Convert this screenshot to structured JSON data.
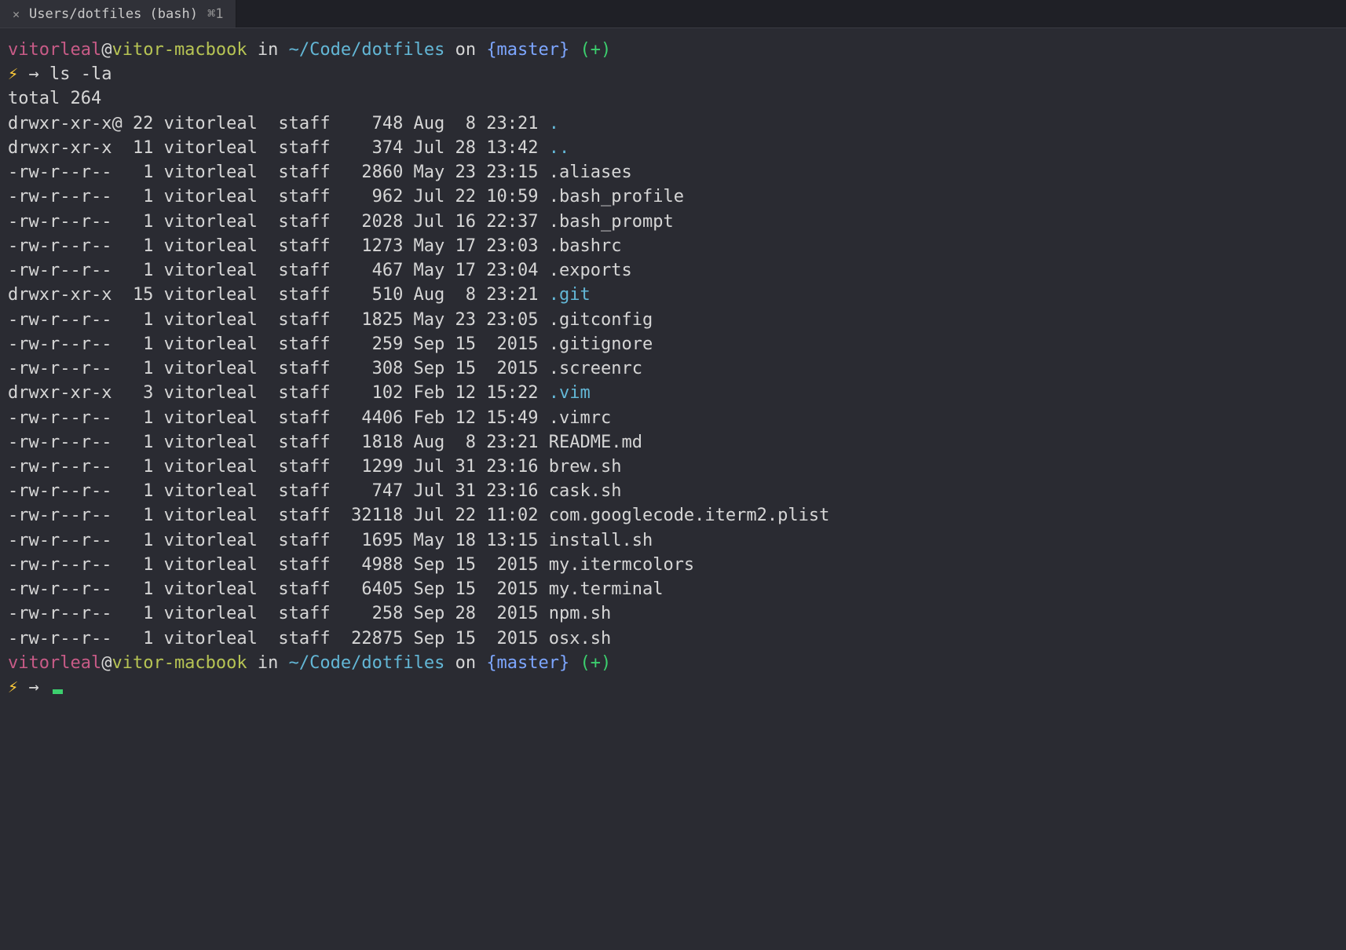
{
  "tab": {
    "label": "Users/dotfiles (bash)",
    "shortcut": "⌘1"
  },
  "colors": {
    "bg": "#2a2b32",
    "tabbar": "#1f2026",
    "user": "#c85b87",
    "host": "#b7c454",
    "path": "#63b7d6",
    "branch": "#7da6ff",
    "plus": "#3ccf6e",
    "bolt": "#ffcb3a",
    "text": "#d6d6d6"
  },
  "prompt": {
    "user": "vitorleal",
    "host": "vitor-macbook",
    "path": "~/Code/dotfiles",
    "branch": "{master}",
    "dirty": "(+)",
    "command": "ls -la"
  },
  "total_line": "total 264",
  "rows": [
    {
      "perm": "drwxr-xr-x@",
      "links": "22",
      "owner": "vitorleal",
      "group": "staff",
      "size": "748",
      "date": "Aug  8 23:21",
      "name": ".",
      "dir": true
    },
    {
      "perm": "drwxr-xr-x",
      "links": "11",
      "owner": "vitorleal",
      "group": "staff",
      "size": "374",
      "date": "Jul 28 13:42",
      "name": "..",
      "dir": true
    },
    {
      "perm": "-rw-r--r--",
      "links": "1",
      "owner": "vitorleal",
      "group": "staff",
      "size": "2860",
      "date": "May 23 23:15",
      "name": ".aliases",
      "dir": false
    },
    {
      "perm": "-rw-r--r--",
      "links": "1",
      "owner": "vitorleal",
      "group": "staff",
      "size": "962",
      "date": "Jul 22 10:59",
      "name": ".bash_profile",
      "dir": false
    },
    {
      "perm": "-rw-r--r--",
      "links": "1",
      "owner": "vitorleal",
      "group": "staff",
      "size": "2028",
      "date": "Jul 16 22:37",
      "name": ".bash_prompt",
      "dir": false
    },
    {
      "perm": "-rw-r--r--",
      "links": "1",
      "owner": "vitorleal",
      "group": "staff",
      "size": "1273",
      "date": "May 17 23:03",
      "name": ".bashrc",
      "dir": false
    },
    {
      "perm": "-rw-r--r--",
      "links": "1",
      "owner": "vitorleal",
      "group": "staff",
      "size": "467",
      "date": "May 17 23:04",
      "name": ".exports",
      "dir": false
    },
    {
      "perm": "drwxr-xr-x",
      "links": "15",
      "owner": "vitorleal",
      "group": "staff",
      "size": "510",
      "date": "Aug  8 23:21",
      "name": ".git",
      "dir": true
    },
    {
      "perm": "-rw-r--r--",
      "links": "1",
      "owner": "vitorleal",
      "group": "staff",
      "size": "1825",
      "date": "May 23 23:05",
      "name": ".gitconfig",
      "dir": false
    },
    {
      "perm": "-rw-r--r--",
      "links": "1",
      "owner": "vitorleal",
      "group": "staff",
      "size": "259",
      "date": "Sep 15  2015",
      "name": ".gitignore",
      "dir": false
    },
    {
      "perm": "-rw-r--r--",
      "links": "1",
      "owner": "vitorleal",
      "group": "staff",
      "size": "308",
      "date": "Sep 15  2015",
      "name": ".screenrc",
      "dir": false
    },
    {
      "perm": "drwxr-xr-x",
      "links": "3",
      "owner": "vitorleal",
      "group": "staff",
      "size": "102",
      "date": "Feb 12 15:22",
      "name": ".vim",
      "dir": true
    },
    {
      "perm": "-rw-r--r--",
      "links": "1",
      "owner": "vitorleal",
      "group": "staff",
      "size": "4406",
      "date": "Feb 12 15:49",
      "name": ".vimrc",
      "dir": false
    },
    {
      "perm": "-rw-r--r--",
      "links": "1",
      "owner": "vitorleal",
      "group": "staff",
      "size": "1818",
      "date": "Aug  8 23:21",
      "name": "README.md",
      "dir": false
    },
    {
      "perm": "-rw-r--r--",
      "links": "1",
      "owner": "vitorleal",
      "group": "staff",
      "size": "1299",
      "date": "Jul 31 23:16",
      "name": "brew.sh",
      "dir": false
    },
    {
      "perm": "-rw-r--r--",
      "links": "1",
      "owner": "vitorleal",
      "group": "staff",
      "size": "747",
      "date": "Jul 31 23:16",
      "name": "cask.sh",
      "dir": false
    },
    {
      "perm": "-rw-r--r--",
      "links": "1",
      "owner": "vitorleal",
      "group": "staff",
      "size": "32118",
      "date": "Jul 22 11:02",
      "name": "com.googlecode.iterm2.plist",
      "dir": false
    },
    {
      "perm": "-rw-r--r--",
      "links": "1",
      "owner": "vitorleal",
      "group": "staff",
      "size": "1695",
      "date": "May 18 13:15",
      "name": "install.sh",
      "dir": false
    },
    {
      "perm": "-rw-r--r--",
      "links": "1",
      "owner": "vitorleal",
      "group": "staff",
      "size": "4988",
      "date": "Sep 15  2015",
      "name": "my.itermcolors",
      "dir": false
    },
    {
      "perm": "-rw-r--r--",
      "links": "1",
      "owner": "vitorleal",
      "group": "staff",
      "size": "6405",
      "date": "Sep 15  2015",
      "name": "my.terminal",
      "dir": false
    },
    {
      "perm": "-rw-r--r--",
      "links": "1",
      "owner": "vitorleal",
      "group": "staff",
      "size": "258",
      "date": "Sep 28  2015",
      "name": "npm.sh",
      "dir": false
    },
    {
      "perm": "-rw-r--r--",
      "links": "1",
      "owner": "vitorleal",
      "group": "staff",
      "size": "22875",
      "date": "Sep 15  2015",
      "name": "osx.sh",
      "dir": false
    }
  ]
}
